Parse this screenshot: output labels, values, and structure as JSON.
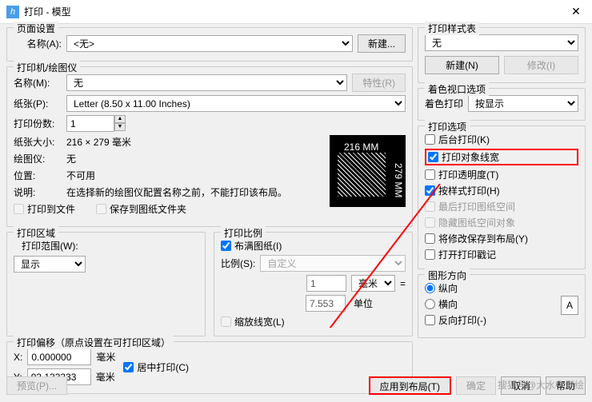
{
  "window": {
    "title": "打印 - 模型"
  },
  "page_setup": {
    "title": "页面设置",
    "name_label": "名称(A):",
    "name_value": "<无>",
    "new_btn": "新建..."
  },
  "printer": {
    "title": "打印机/绘图仪",
    "name_label": "名称(M):",
    "name_value": "无",
    "properties_btn": "特性(R)",
    "paper_label": "纸张(P):",
    "paper_value": "Letter (8.50 x 11.00 Inches)",
    "copies_label": "打印份数:",
    "copies_value": "1",
    "paper_size_label": "纸张大小:",
    "paper_size_value": "216 × 279  毫米",
    "plotter_label": "绘图仪:",
    "plotter_value": "无",
    "location_label": "位置:",
    "location_value": "不可用",
    "desc_label": "说明:",
    "desc_value": "在选择新的绘图仪配置名称之前，不能打印该布局。",
    "print_to_file": "打印到文件",
    "save_paper": "保存到图纸文件夹",
    "preview_top": "216 MM",
    "preview_right": "279 MM"
  },
  "print_area": {
    "title": "打印区域",
    "range_label": "打印范围(W):",
    "range_value": "显示"
  },
  "print_scale": {
    "title": "打印比例",
    "fit_paper": "布满图纸(I)",
    "scale_label": "比例(S):",
    "scale_value": "自定义",
    "val1": "1",
    "unit1": "毫米",
    "eq": "=",
    "val2": "7.553",
    "unit2": "单位",
    "scale_lw": "缩放线宽(L)"
  },
  "print_offset": {
    "title": "打印偏移（原点设置在可打印区域）",
    "x_label": "X:",
    "x_value": "0.000000",
    "y_label": "Y:",
    "y_value": "93.133333",
    "unit": "毫米",
    "center": "居中打印(C)"
  },
  "style_table": {
    "title": "打印样式表",
    "value": "无",
    "new_btn": "新建(N)",
    "modify_btn": "修改(I)"
  },
  "shade_viewport": {
    "title": "着色视口选项",
    "label": "着色打印",
    "value": "按显示"
  },
  "print_options": {
    "title": "打印选项",
    "bg_print": "后台打印(K)",
    "obj_lw": "打印对象线宽",
    "transparency": "打印透明度(T)",
    "by_style": "按样式打印(H)",
    "last_space": "最后打印图纸空间",
    "hide_space": "隐藏图纸空间对象",
    "save_layout": "将修改保存到布局(Y)",
    "open_stamp": "打开打印戳记"
  },
  "orientation": {
    "title": "图形方向",
    "portrait": "纵向",
    "landscape": "横向",
    "reverse": "反向打印(-)"
  },
  "footer": {
    "preview": "预览(P)...",
    "apply": "应用到布局(T)",
    "ok": "确定",
    "cancel": "取消",
    "help": "帮助"
  },
  "watermark": "搜狐号@大水牛测绘"
}
